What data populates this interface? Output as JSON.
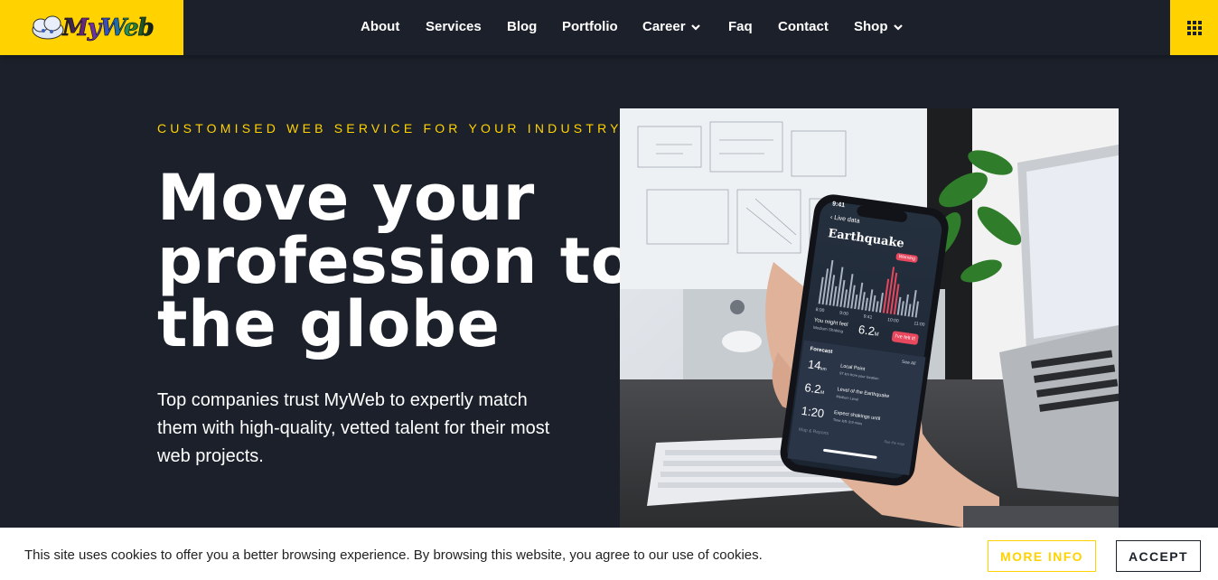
{
  "brand": {
    "logo_text": "MyWeb"
  },
  "nav": {
    "items": [
      {
        "label": "About",
        "dropdown": false
      },
      {
        "label": "Services",
        "dropdown": false
      },
      {
        "label": "Blog",
        "dropdown": false
      },
      {
        "label": "Portfolio",
        "dropdown": false
      },
      {
        "label": "Career",
        "dropdown": true
      },
      {
        "label": "Faq",
        "dropdown": false
      },
      {
        "label": "Contact",
        "dropdown": false
      },
      {
        "label": "Shop",
        "dropdown": true
      }
    ],
    "menu_icon": "grid-icon"
  },
  "hero": {
    "eyebrow": "CUSTOMISED WEB SERVICE FOR YOUR INDUSTRY",
    "headline_lines": [
      "Move your",
      "profession to",
      "the globe"
    ],
    "lede": "Top companies trust MyWeb to expertly match them with high-quality, vetted talent for their most web projects."
  },
  "phone_screen": {
    "time": "9:41",
    "back_label": "Live data",
    "title": "Earthquake",
    "warning": "Warning",
    "axis": [
      "8:00",
      "9:00",
      "9:41",
      "10:00",
      "11:00"
    ],
    "feel_label": "You might feel",
    "feel_sub": "Medium Shaking",
    "feel_value": "6.2",
    "feel_unit": "M",
    "felt_button": "I've felt it!",
    "forecast": "Forecast",
    "see_all": "See All",
    "rows": [
      {
        "value": "14",
        "unit": "km",
        "label": "Local Point",
        "sub": "97 km from your location"
      },
      {
        "value": "6.2",
        "unit": "M",
        "label": "Level of the Earthquake",
        "sub": "Medium Level"
      },
      {
        "value": "1:20",
        "unit": "",
        "label": "Expect shakings until",
        "sub": "Time left: 9:9 mins"
      }
    ],
    "footer_left": "Map & Reports",
    "footer_right": "See the map"
  },
  "cookie": {
    "text": "This site uses cookies to offer you a better browsing experience. By browsing this website, you agree to our use of cookies.",
    "more_info": "MORE INFO",
    "accept": "ACCEPT"
  },
  "colors": {
    "accent": "#ffd200",
    "background": "#1b202a",
    "alert": "#e8485e"
  }
}
